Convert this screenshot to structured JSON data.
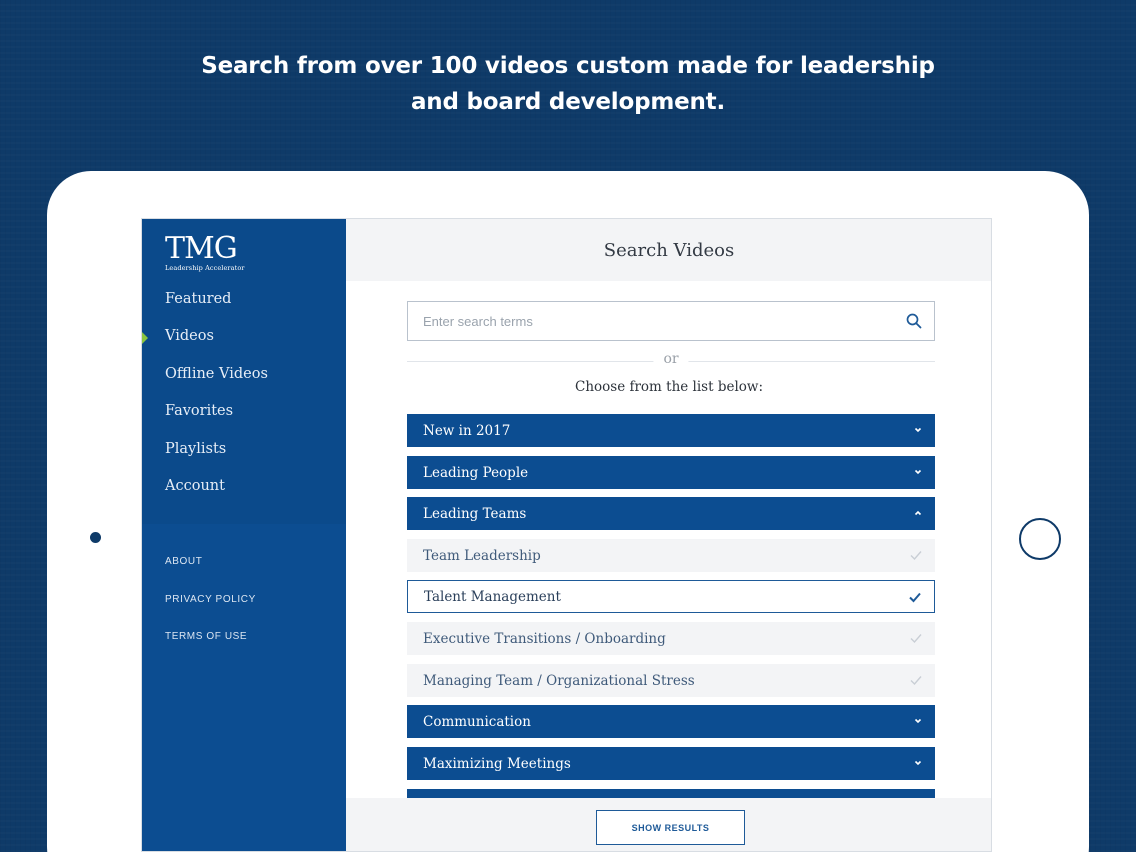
{
  "headline": {
    "line1": "Search from over 100 videos custom made for leadership",
    "line2": "and board development."
  },
  "colors": {
    "background": "#0e3a68",
    "sidebar": "#0c4d91",
    "accent": "#8cc63f",
    "category_bar": "#0c4d91"
  },
  "logo": {
    "mark": "TMG",
    "subtitle": "Leadership Accelerator"
  },
  "sidebar": {
    "items": [
      {
        "label": "Featured"
      },
      {
        "label": "Videos",
        "active": true
      },
      {
        "label": "Offline Videos"
      },
      {
        "label": "Favorites"
      },
      {
        "label": "Playlists"
      },
      {
        "label": "Account"
      }
    ],
    "footer": [
      {
        "label": "ABOUT"
      },
      {
        "label": "PRIVACY POLICY"
      },
      {
        "label": "TERMS OF USE"
      }
    ]
  },
  "main": {
    "title": "Search Videos",
    "search": {
      "placeholder": "Enter search terms",
      "value": "",
      "icon": "search-icon"
    },
    "or_text": "or",
    "choose_text": "Choose from the list below:",
    "categories": [
      {
        "label": "New in 2017",
        "expanded": false
      },
      {
        "label": "Leading People",
        "expanded": false
      },
      {
        "label": "Leading Teams",
        "expanded": true
      },
      {
        "label": "Communication",
        "expanded": false
      },
      {
        "label": "Maximizing Meetings",
        "expanded": false
      }
    ],
    "subcategories": [
      {
        "label": "Team Leadership",
        "selected": false
      },
      {
        "label": "Talent Management",
        "selected": true
      },
      {
        "label": "Executive Transitions / Onboarding",
        "selected": false
      },
      {
        "label": "Managing Team / Organizational Stress",
        "selected": false
      }
    ],
    "show_results_label": "SHOW RESULTS"
  }
}
